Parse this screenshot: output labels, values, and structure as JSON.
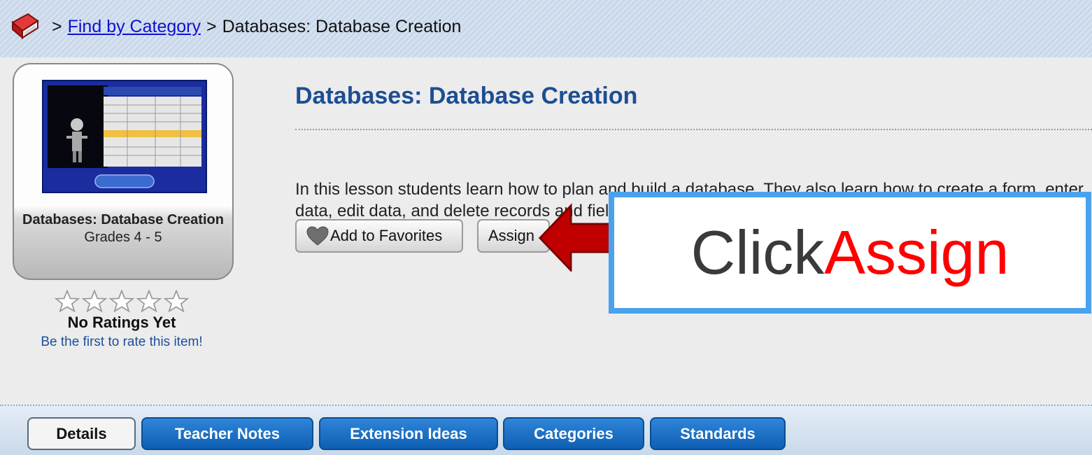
{
  "breadcrumb": {
    "separator": ">",
    "link": "Find by Category",
    "current": "Databases: Database Creation"
  },
  "thumbnail": {
    "title": "Databases: Database Creation",
    "grades": "Grades 4 - 5"
  },
  "rating": {
    "stars_filled": 0,
    "stars_total": 5,
    "no_ratings": "No Ratings Yet",
    "first_rate": "Be the first to rate this item!"
  },
  "lesson": {
    "title": "Databases: Database Creation",
    "description": "In this lesson students learn how to plan and build a database. They also learn how to create a form, enter data, edit data, and delete records and fields."
  },
  "buttons": {
    "favorites": "Add to Favorites",
    "assign": "Assign"
  },
  "callout": {
    "word1": "Click",
    "word2": "Assign"
  },
  "tabs": {
    "details": "Details",
    "teacher_notes": "Teacher Notes",
    "extension_ideas": "Extension Ideas",
    "categories": "Categories",
    "standards": "Standards"
  },
  "colors": {
    "title_blue": "#1c4e93",
    "tab_blue": "#0e5fb4",
    "callout_border": "#4aa2ee",
    "callout_accent": "#ff0000",
    "arrow_red": "#c00000"
  }
}
